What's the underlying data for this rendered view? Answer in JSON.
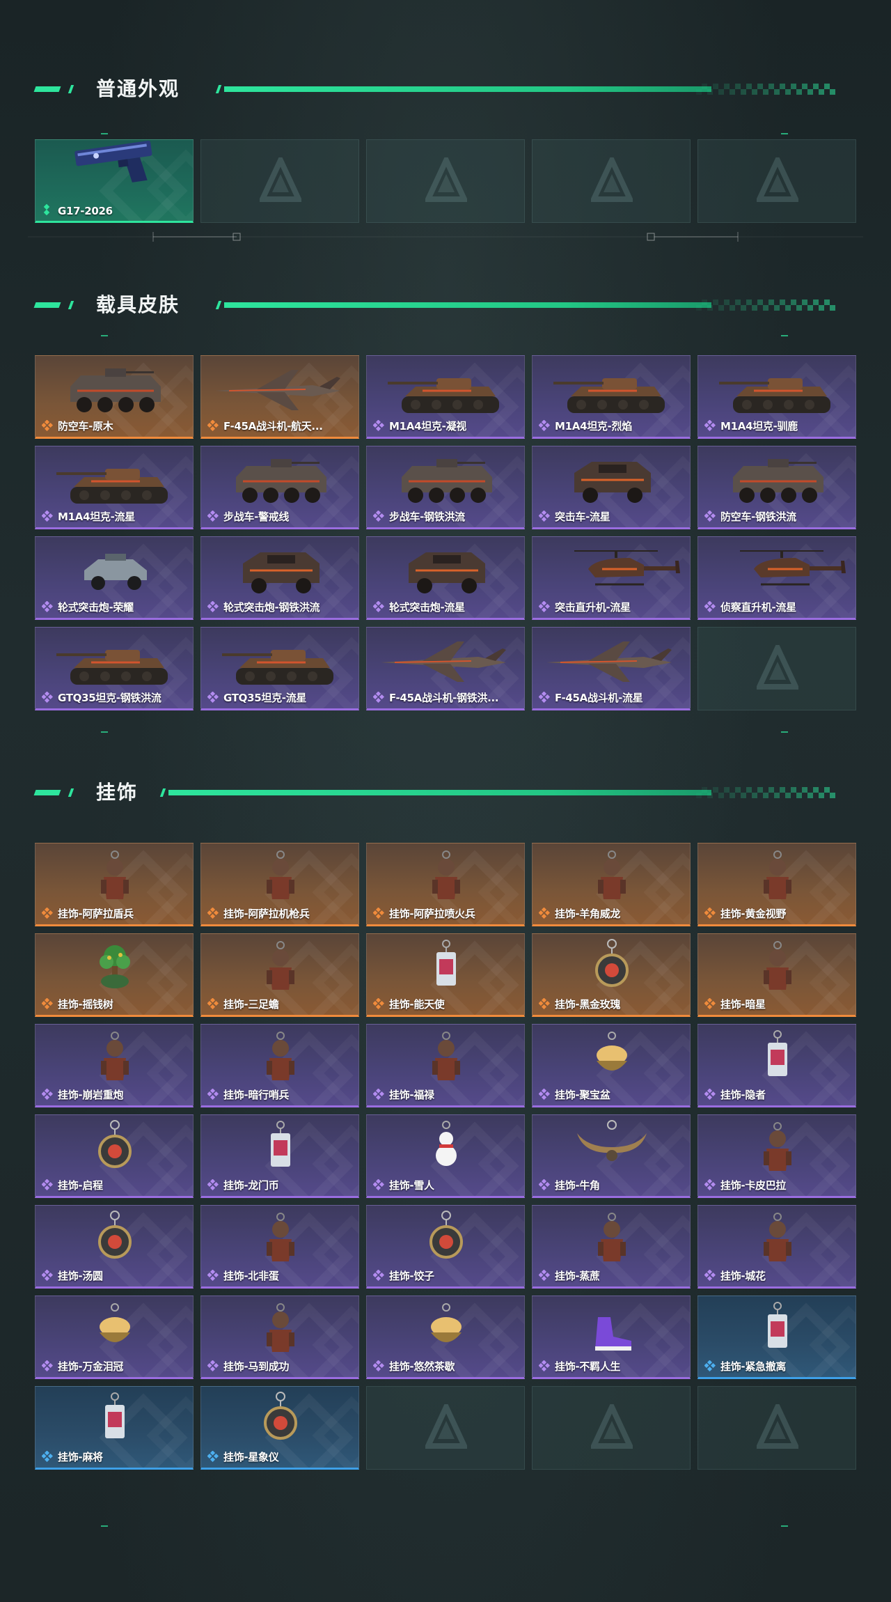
{
  "colors": {
    "accent": "#2ee59d",
    "orange": "#f08b3c",
    "purple": "#9a6de0",
    "blue": "#3ea0e8"
  },
  "sections": {
    "normal": {
      "title": "普通外观",
      "items": [
        {
          "label": "G17-2026",
          "rarity": "green",
          "art": "pistol"
        },
        {
          "label": "",
          "rarity": "empty"
        },
        {
          "label": "",
          "rarity": "empty"
        },
        {
          "label": "",
          "rarity": "empty"
        },
        {
          "label": "",
          "rarity": "empty"
        }
      ]
    },
    "vehicle": {
      "title": "载具皮肤",
      "items": [
        {
          "label": "防空车-原木",
          "rarity": "orange",
          "art": "apc"
        },
        {
          "label": "F-45A战斗机-航天...",
          "rarity": "orange",
          "art": "jet"
        },
        {
          "label": "M1A4坦克-凝视",
          "rarity": "purple",
          "art": "tank"
        },
        {
          "label": "M1A4坦克-烈焰",
          "rarity": "purple",
          "art": "tank"
        },
        {
          "label": "M1A4坦克-驯鹿",
          "rarity": "purple",
          "art": "tank"
        },
        {
          "label": "M1A4坦克-流星",
          "rarity": "purple",
          "art": "tank"
        },
        {
          "label": "步战车-警戒线",
          "rarity": "purple",
          "art": "apc"
        },
        {
          "label": "步战车-钢铁洪流",
          "rarity": "purple",
          "art": "apc"
        },
        {
          "label": "突击车-流星",
          "rarity": "purple",
          "art": "truck"
        },
        {
          "label": "防空车-钢铁洪流",
          "rarity": "purple",
          "art": "apc"
        },
        {
          "label": "轮式突击炮-荣耀",
          "rarity": "purple",
          "art": "buggy"
        },
        {
          "label": "轮式突击炮-钢铁洪流",
          "rarity": "purple",
          "art": "truck"
        },
        {
          "label": "轮式突击炮-流星",
          "rarity": "purple",
          "art": "truck"
        },
        {
          "label": "突击直升机-流星",
          "rarity": "purple",
          "art": "heli"
        },
        {
          "label": "侦察直升机-流星",
          "rarity": "purple",
          "art": "heli"
        },
        {
          "label": "GTQ35坦克-钢铁洪流",
          "rarity": "purple",
          "art": "tank"
        },
        {
          "label": "GTQ35坦克-流星",
          "rarity": "purple",
          "art": "tank"
        },
        {
          "label": "F-45A战斗机-钢铁洪...",
          "rarity": "purple",
          "art": "jet"
        },
        {
          "label": "F-45A战斗机-流星",
          "rarity": "purple",
          "art": "jet"
        },
        {
          "label": "",
          "rarity": "empty"
        }
      ]
    },
    "charm": {
      "title": "挂饰",
      "items": [
        {
          "label": "挂饰-阿萨拉盾兵",
          "rarity": "orange",
          "art": "figure"
        },
        {
          "label": "挂饰-阿萨拉机枪兵",
          "rarity": "orange",
          "art": "figure"
        },
        {
          "label": "挂饰-阿萨拉喷火兵",
          "rarity": "orange",
          "art": "figure"
        },
        {
          "label": "挂饰-羊角威龙",
          "rarity": "orange",
          "art": "figure"
        },
        {
          "label": "挂饰-黄金视野",
          "rarity": "orange",
          "art": "figure"
        },
        {
          "label": "挂饰-摇钱树",
          "rarity": "orange",
          "art": "tree"
        },
        {
          "label": "挂饰-三足蟾",
          "rarity": "orange",
          "art": "figure"
        },
        {
          "label": "挂饰-能天使",
          "rarity": "orange",
          "art": "tag"
        },
        {
          "label": "挂饰-黑金玫瑰",
          "rarity": "orange",
          "art": "ring"
        },
        {
          "label": "挂饰-暗星",
          "rarity": "orange",
          "art": "figure"
        },
        {
          "label": "挂饰-崩岩重炮",
          "rarity": "purple",
          "art": "figure"
        },
        {
          "label": "挂饰-暗行哨兵",
          "rarity": "purple",
          "art": "figure"
        },
        {
          "label": "挂饰-福禄",
          "rarity": "purple",
          "art": "figure"
        },
        {
          "label": "挂饰-聚宝盆",
          "rarity": "purple",
          "art": "bowl"
        },
        {
          "label": "挂饰-隐者",
          "rarity": "purple",
          "art": "tag"
        },
        {
          "label": "挂饰-启程",
          "rarity": "purple",
          "art": "ring"
        },
        {
          "label": "挂饰-龙门币",
          "rarity": "purple",
          "art": "tag"
        },
        {
          "label": "挂饰-雪人",
          "rarity": "purple",
          "art": "snowman"
        },
        {
          "label": "挂饰-牛角",
          "rarity": "purple",
          "art": "horns"
        },
        {
          "label": "挂饰-卡皮巴拉",
          "rarity": "purple",
          "art": "figure"
        },
        {
          "label": "挂饰-汤圆",
          "rarity": "purple",
          "art": "ring"
        },
        {
          "label": "挂饰-北非蛋",
          "rarity": "purple",
          "art": "figure"
        },
        {
          "label": "挂饰-饺子",
          "rarity": "purple",
          "art": "ring"
        },
        {
          "label": "挂饰-蒸蔗",
          "rarity": "purple",
          "art": "figure"
        },
        {
          "label": "挂饰-城花",
          "rarity": "purple",
          "art": "figure"
        },
        {
          "label": "挂饰-万金泪冠",
          "rarity": "purple",
          "art": "bowl"
        },
        {
          "label": "挂饰-马到成功",
          "rarity": "purple",
          "art": "figure"
        },
        {
          "label": "挂饰-悠然茶歇",
          "rarity": "purple",
          "art": "bowl"
        },
        {
          "label": "挂饰-不羁人生",
          "rarity": "purple",
          "art": "shoe"
        },
        {
          "label": "挂饰-紧急撤离",
          "rarity": "blue",
          "art": "tag"
        },
        {
          "label": "挂饰-麻将",
          "rarity": "blue",
          "art": "tag"
        },
        {
          "label": "挂饰-星象仪",
          "rarity": "blue",
          "art": "ring"
        },
        {
          "label": "",
          "rarity": "empty"
        },
        {
          "label": "",
          "rarity": "empty"
        },
        {
          "label": "",
          "rarity": "empty"
        }
      ]
    }
  }
}
